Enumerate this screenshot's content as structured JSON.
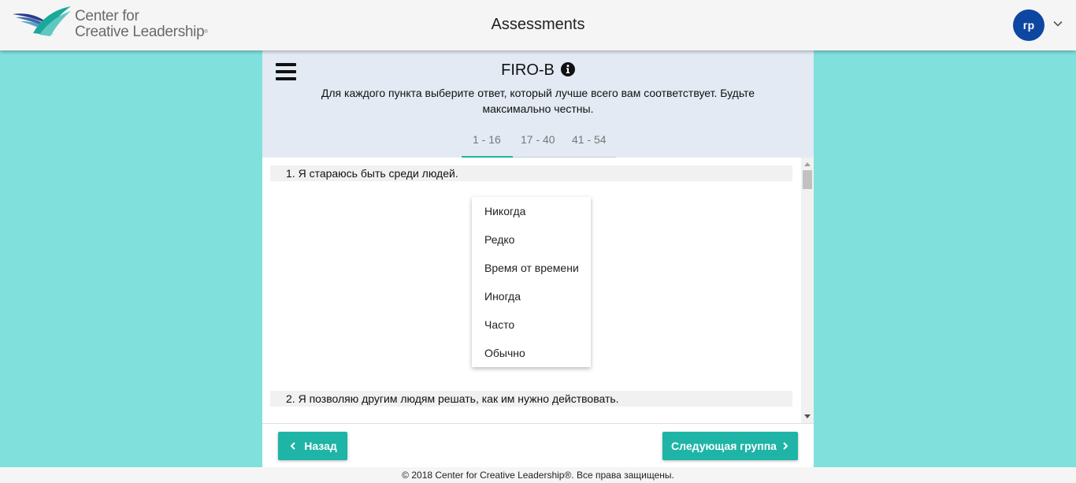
{
  "header": {
    "logo_line1": "Center for",
    "logo_line2": "Creative Leadership",
    "logo_mark": "®",
    "title": "Assessments",
    "user_initials": "гр"
  },
  "test": {
    "title": "FIRO-B",
    "instructions": "Для каждого пункта выберите ответ, который лучше всего вам соответствует. Будьте максимально честны.",
    "tabs": [
      {
        "label": "1 - 16",
        "active": true
      },
      {
        "label": "17 - 40",
        "active": false
      },
      {
        "label": "41 - 54",
        "active": false
      }
    ]
  },
  "questions": [
    {
      "text": "1. Я стараюсь быть среди людей."
    },
    {
      "text": "2. Я позволяю другим людям решать, как им нужно действовать."
    }
  ],
  "options": [
    "Никогда",
    "Редко",
    "Время от времени",
    "Иногда",
    "Часто",
    "Обычно"
  ],
  "nav": {
    "back_label": "Назад",
    "next_label": "Следующая группа"
  },
  "footer": {
    "copyright": "© 2018 Center for Creative Leadership®. Все права защищены."
  },
  "colors": {
    "accent": "#1eb4a6",
    "page_background": "#80e0dc",
    "header_panel": "#e3eaf4",
    "avatar": "#0d47a1"
  },
  "icons": [
    "menu-icon",
    "info-icon",
    "chevron-down-icon",
    "chevron-left-icon",
    "chevron-right-icon"
  ]
}
